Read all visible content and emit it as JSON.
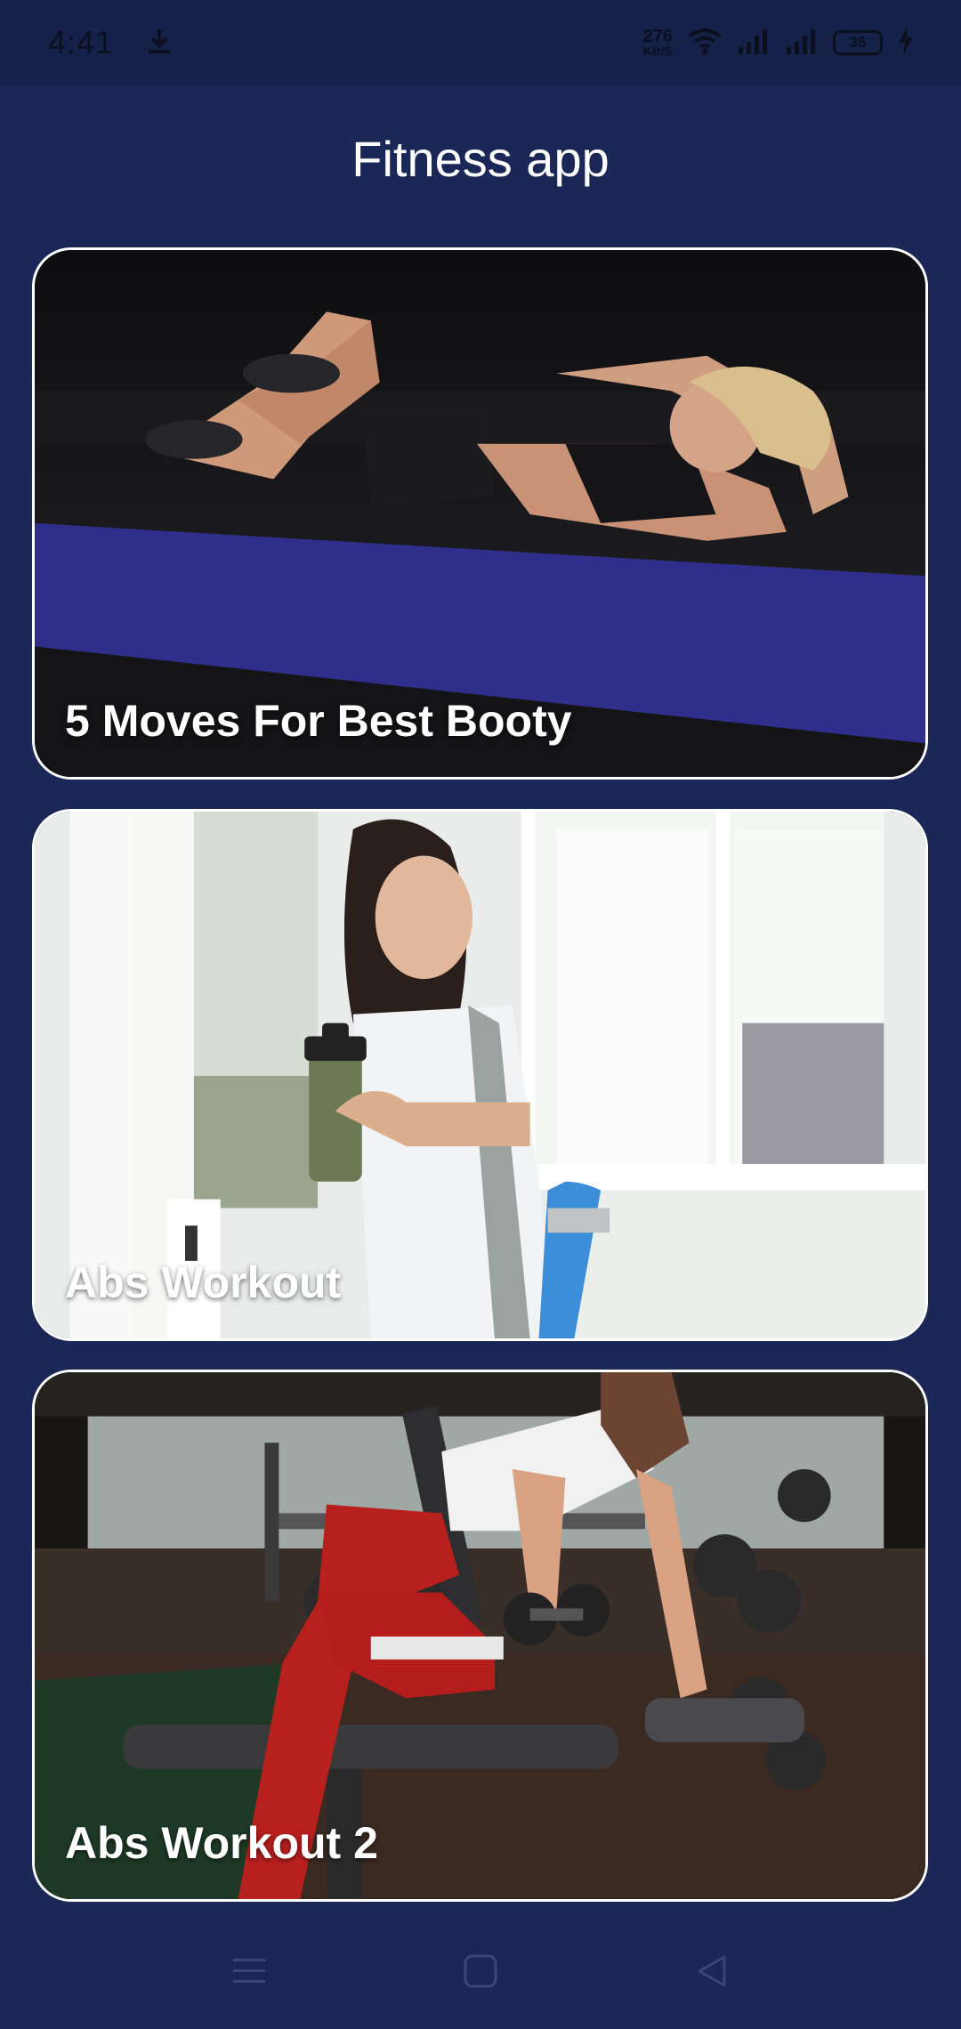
{
  "status_bar": {
    "time": "4:41",
    "net_speed_value": "276",
    "net_speed_unit": "KB/S",
    "battery_level": "36",
    "icons": [
      "download-icon",
      "wifi-icon",
      "signal-icon",
      "signal-icon",
      "battery-icon",
      "charging-icon"
    ]
  },
  "app": {
    "title": "Fitness app"
  },
  "cards": [
    {
      "title": "5 Moves For Best Booty"
    },
    {
      "title": "Abs Workout"
    },
    {
      "title": "Abs Workout 2"
    }
  ],
  "nav_bar": {
    "icons": [
      "menu-icon",
      "home-square-icon",
      "back-triangle-icon"
    ]
  },
  "colors": {
    "background": "#1b2756",
    "status_bar": "#16214a",
    "card_border": "#ffffff",
    "text": "#ffffff"
  }
}
